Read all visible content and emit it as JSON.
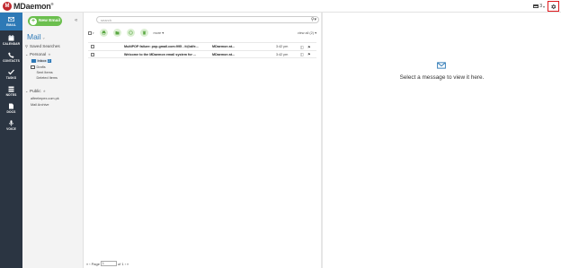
{
  "app": {
    "brand": "MDaemon",
    "brand_initial": "M",
    "brand_mark": "®"
  },
  "topbar": {
    "tray_count": "3",
    "settings_icon": "gear-icon",
    "highlight_color": "#e0191e"
  },
  "nav": [
    {
      "label": "EMAIL",
      "icon": "envelope-icon",
      "active": true
    },
    {
      "label": "CALENDAR",
      "icon": "calendar-icon",
      "active": false
    },
    {
      "label": "CONTACTS",
      "icon": "phone-icon",
      "active": false
    },
    {
      "label": "TASKS",
      "icon": "checkmark-icon",
      "active": false
    },
    {
      "label": "NOTES",
      "icon": "notes-icon",
      "active": false
    },
    {
      "label": "DOCS",
      "icon": "document-icon",
      "active": false
    },
    {
      "label": "VOICE",
      "icon": "microphone-icon",
      "active": false
    }
  ],
  "folders": {
    "new_email": "New Email",
    "title": "Mail",
    "saved_searches": "Saved Searches",
    "personal": "Personal",
    "inbox": "Inbox",
    "inbox_count": "2",
    "drafts": "Drafts",
    "sent": "Sent Items",
    "deleted": "Deleted Items",
    "public": "Public",
    "public_items": [
      "alfeelmpex.com.pk",
      "Mail Archive"
    ]
  },
  "list": {
    "search_placeholder": "search",
    "more": "more",
    "view_all": "view all (2)",
    "messages": [
      {
        "subject": "MultiPOP failure: pop.gmail.com:995 - it@alfe...",
        "from": "MDaemon at...",
        "time": "3:42 pm"
      },
      {
        "subject": "Welcome to the MDaemon email system for ...",
        "from": "MDaemon at...",
        "time": "3:42 pm"
      }
    ],
    "pager": {
      "page_label": "Page",
      "page_value": "1",
      "of_label": "of 1"
    }
  },
  "reading": {
    "placeholder": "Select a message to view it here."
  },
  "colors": {
    "nav_bg": "#2b3542",
    "nav_active": "#2d79b6",
    "new_email": "#6bbf4e",
    "accent": "#2d79b6"
  }
}
